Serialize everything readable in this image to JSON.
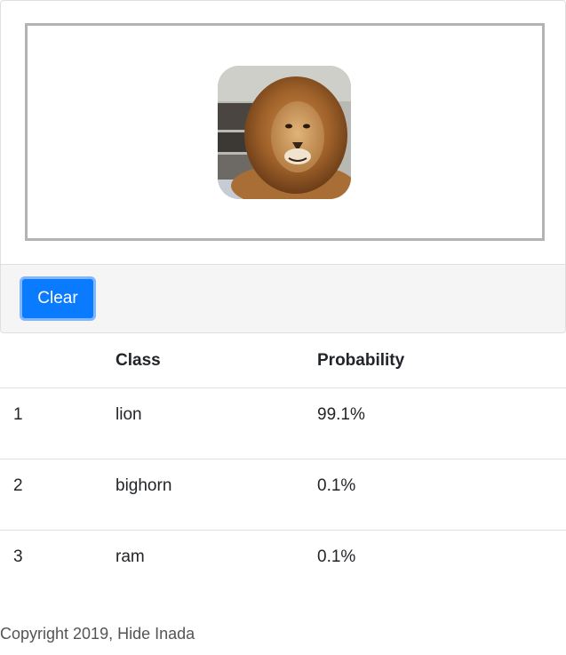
{
  "uploader": {
    "image_alt": "lion",
    "clear_label": "Clear"
  },
  "results": {
    "headers": [
      "",
      "Class",
      "Probability"
    ],
    "rows": [
      {
        "rank": "1",
        "class": "lion",
        "probability": "99.1%"
      },
      {
        "rank": "2",
        "class": "bighorn",
        "probability": "0.1%"
      },
      {
        "rank": "3",
        "class": "ram",
        "probability": "0.1%"
      }
    ]
  },
  "footer": {
    "copyright": "Copyright 2019, Hide Inada"
  },
  "colors": {
    "accent": "#0a7bff",
    "accent_ring": "#7fb7ff",
    "dropzone_border": "#b3b3b3",
    "footer_bg": "#f5f5f5"
  }
}
